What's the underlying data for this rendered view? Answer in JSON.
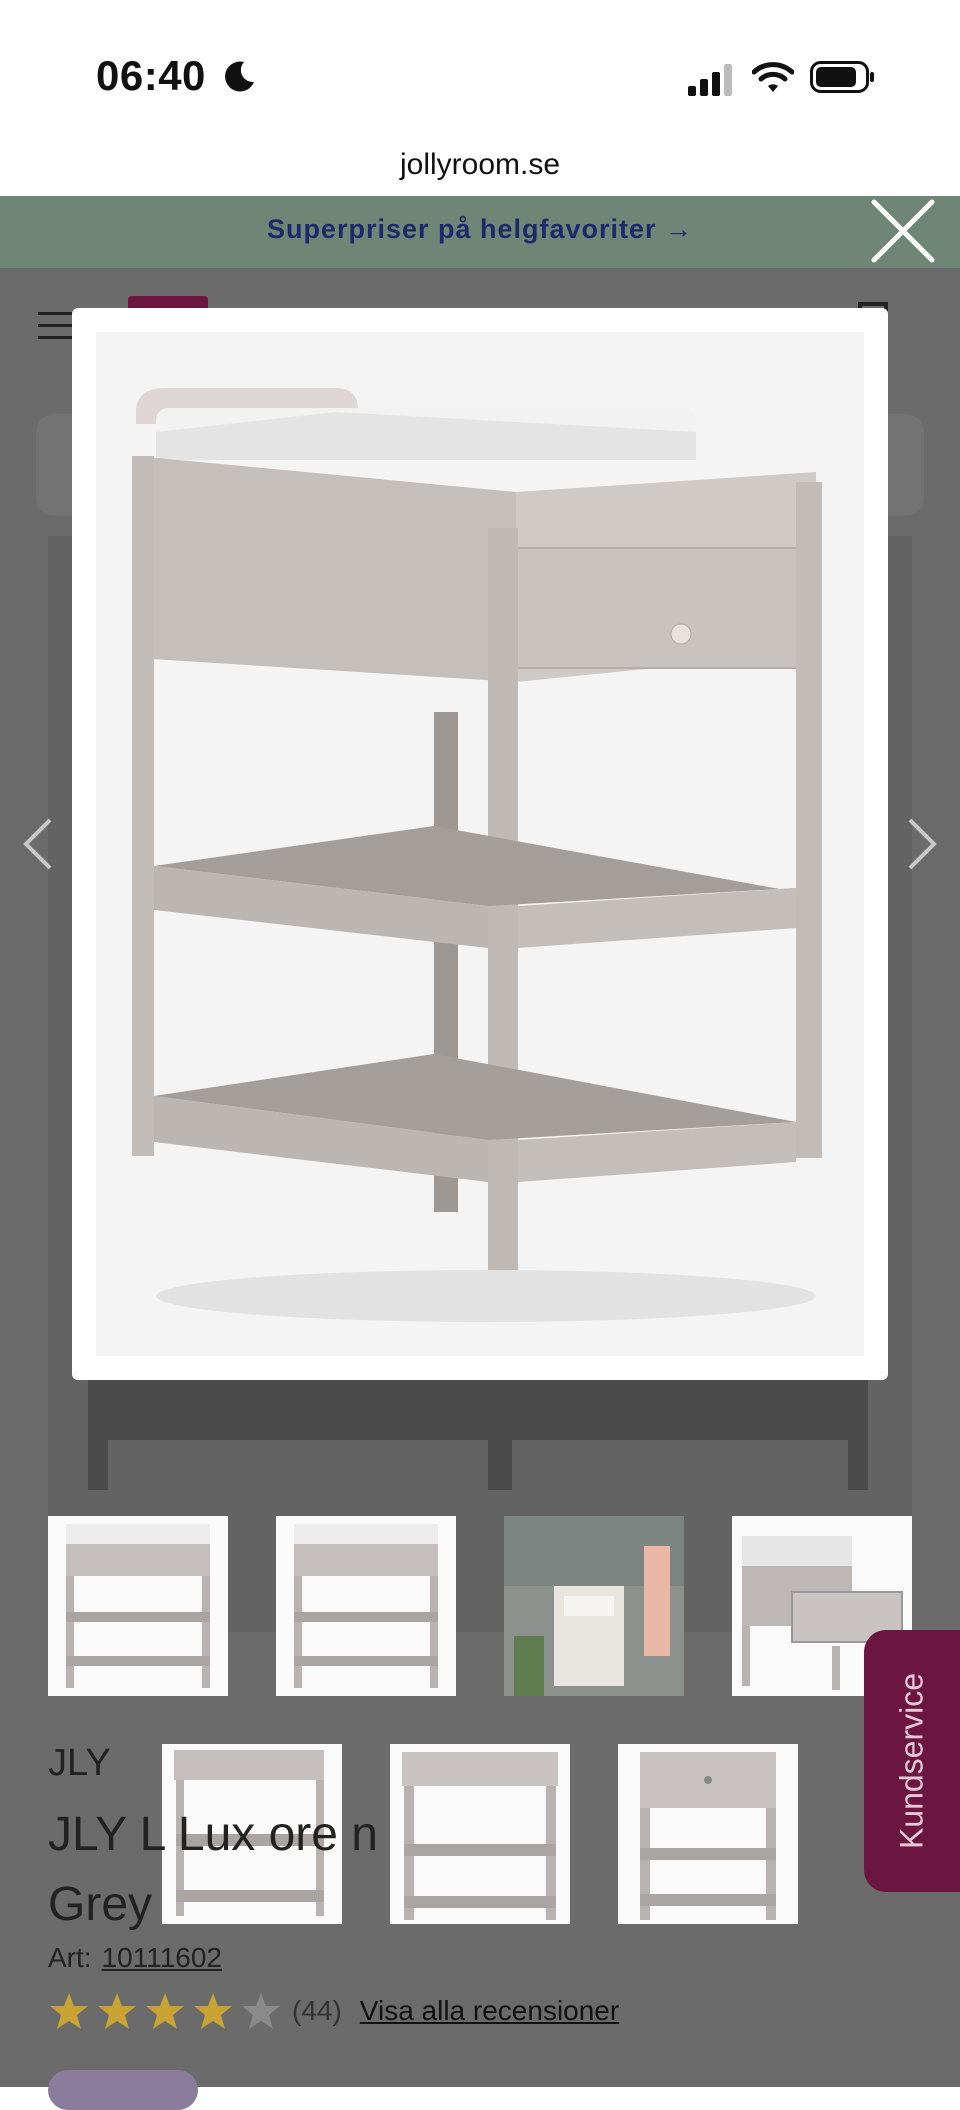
{
  "status_bar": {
    "time": "06:40"
  },
  "browser": {
    "url": "jollyroom.se"
  },
  "promo": {
    "text": "Superpriser på helgfavoriter →"
  },
  "product": {
    "brand": "JLY",
    "title_line1": "JLY L        Lux        ore        n",
    "title_line2": "Grey",
    "art_label": "Art:",
    "art_number": "10111602",
    "rating": 4,
    "rating_max": 5,
    "review_count": "(44)",
    "reviews_link": "Visa alla recensioner"
  },
  "kundservice": {
    "label": "Kundservice"
  },
  "colors": {
    "promo_bg": "#6f8677",
    "brand": "#6a1640",
    "overlay": "#6b6b6b",
    "star": "#c8a233"
  },
  "icons": [
    "moon-icon",
    "signal-icon",
    "wifi-icon",
    "battery-icon",
    "close-icon",
    "hamburger-icon",
    "chevron-left-icon",
    "chevron-right-icon",
    "star-icon"
  ]
}
